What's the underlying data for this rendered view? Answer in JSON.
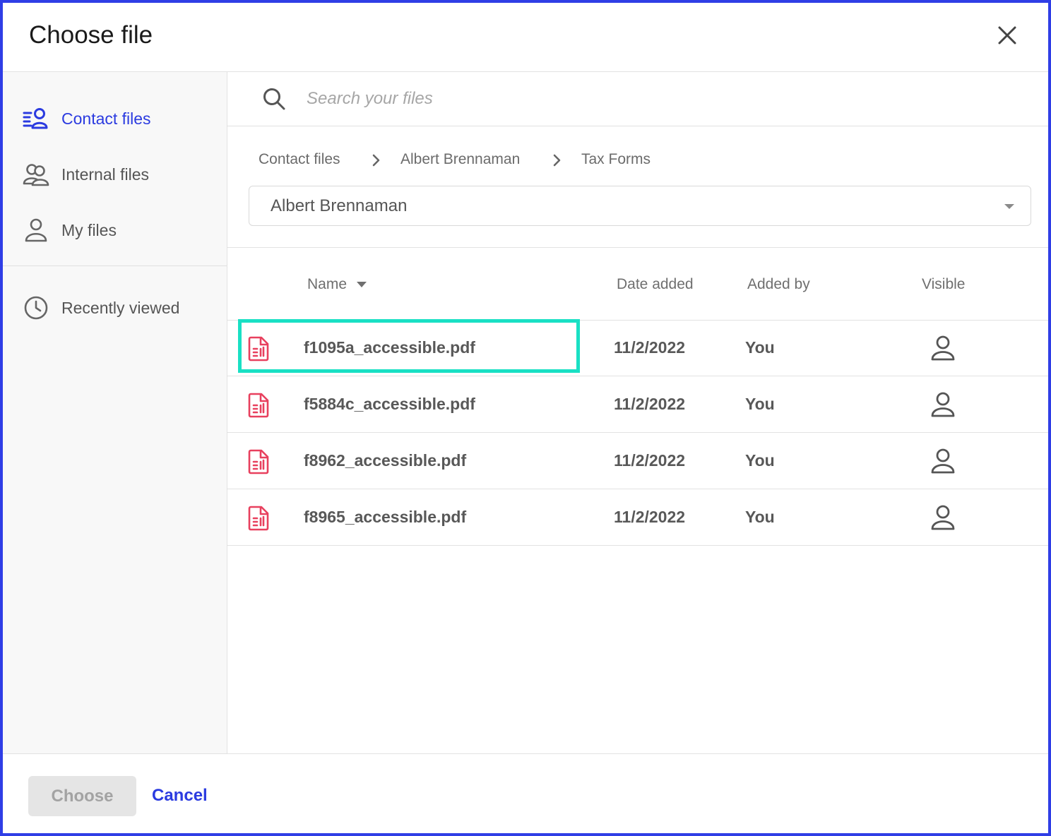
{
  "dialog": {
    "title": "Choose file",
    "close_icon": "close-icon"
  },
  "sidebar": {
    "items": [
      {
        "label": "Contact files",
        "icon": "contact-files-icon",
        "active": true
      },
      {
        "label": "Internal files",
        "icon": "users-icon",
        "active": false
      },
      {
        "label": "My files",
        "icon": "user-icon",
        "active": false
      },
      {
        "label": "Recently viewed",
        "icon": "clock-icon",
        "active": false
      }
    ]
  },
  "search": {
    "placeholder": "Search your files",
    "value": ""
  },
  "breadcrumb": [
    "Contact files",
    "Albert Brennaman",
    "Tax Forms"
  ],
  "contact_select": {
    "value": "Albert Brennaman"
  },
  "table": {
    "columns": [
      "Name",
      "Date added",
      "Added by",
      "Visible"
    ],
    "sort_column": "Name",
    "rows": [
      {
        "name": "f1095a_accessible.pdf",
        "date": "11/2/2022",
        "added_by": "You",
        "visible_icon": "user-icon"
      },
      {
        "name": "f5884c_accessible.pdf",
        "date": "11/2/2022",
        "added_by": "You",
        "visible_icon": "user-icon"
      },
      {
        "name": "f8962_accessible.pdf",
        "date": "11/2/2022",
        "added_by": "You",
        "visible_icon": "user-icon"
      },
      {
        "name": "f8965_accessible.pdf",
        "date": "11/2/2022",
        "added_by": "You",
        "visible_icon": "user-icon"
      }
    ],
    "highlighted_row": 0
  },
  "footer": {
    "choose_label": "Choose",
    "cancel_label": "Cancel"
  },
  "colors": {
    "accent": "#2b3be0",
    "border": "#2f3ee6",
    "pdf_icon": "#e8405e",
    "highlight": "#19e0c4",
    "disabled_bg": "#e5e5e5"
  }
}
